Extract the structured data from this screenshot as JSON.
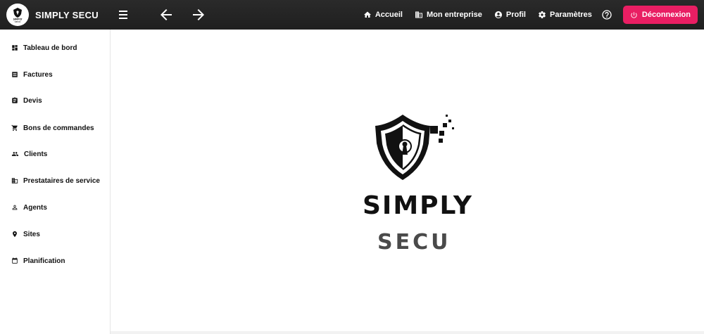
{
  "header": {
    "brand_title": "SIMPLY SECU",
    "logo_small_line1": "SIMPLY",
    "logo_small_line2": "SECU",
    "nav": {
      "home": "Accueil",
      "company": "Mon entreprise",
      "profile": "Profil",
      "settings": "Paramètres"
    },
    "logout_label": "Déconnexion",
    "icons": [
      "menu-icon",
      "arrow-left-icon",
      "arrow-right-icon",
      "home-icon",
      "building-icon",
      "account-circle-icon",
      "gear-icon",
      "help-icon",
      "power-icon"
    ]
  },
  "sidebar": {
    "items": [
      {
        "label": "Tableau de bord",
        "icon": "dashboard-icon"
      },
      {
        "label": "Factures",
        "icon": "list-icon"
      },
      {
        "label": "Devis",
        "icon": "clipboard-icon"
      },
      {
        "label": "Bons de commandes",
        "icon": "cart-icon"
      },
      {
        "label": "Clients",
        "icon": "people-icon"
      },
      {
        "label": "Prestataires de service",
        "icon": "building-icon"
      },
      {
        "label": "Agents",
        "icon": "person-icon"
      },
      {
        "label": "Sites",
        "icon": "map-pin-icon"
      },
      {
        "label": "Planification",
        "icon": "calendar-icon"
      }
    ]
  },
  "main": {
    "logo_line1": "SIMPLY",
    "logo_line2": "SECU"
  },
  "colors": {
    "topbar": "#222222",
    "accent": "#e91e63",
    "logo_secondary": "#4a4a4a"
  }
}
